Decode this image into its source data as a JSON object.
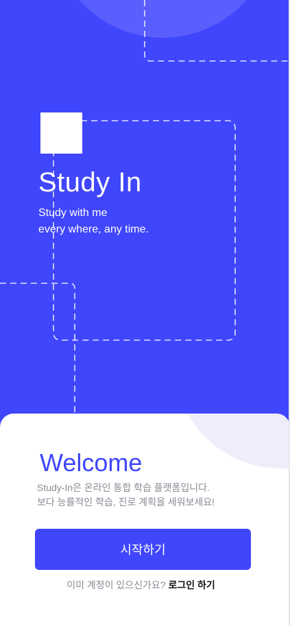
{
  "hero": {
    "title": "Study In",
    "tagline_line1": "Study with me",
    "tagline_line2": "every where, any time."
  },
  "welcome": {
    "title": "Welcome",
    "desc_line1": "Study-In은 온라인 통합 학습 플랫폼입니다.",
    "desc_line2": "보다 능률적인 학습, 진로 계획을 세워보세요!"
  },
  "actions": {
    "start_label": "시작하기",
    "login_prompt": "이미 계정이 있으신가요?",
    "login_link": "로그인 하기"
  },
  "colors": {
    "primary": "#4046fb",
    "hero_circle": "#5a5efc",
    "sheet_circle": "#eeeefb",
    "muted_text": "#8a8a96"
  }
}
